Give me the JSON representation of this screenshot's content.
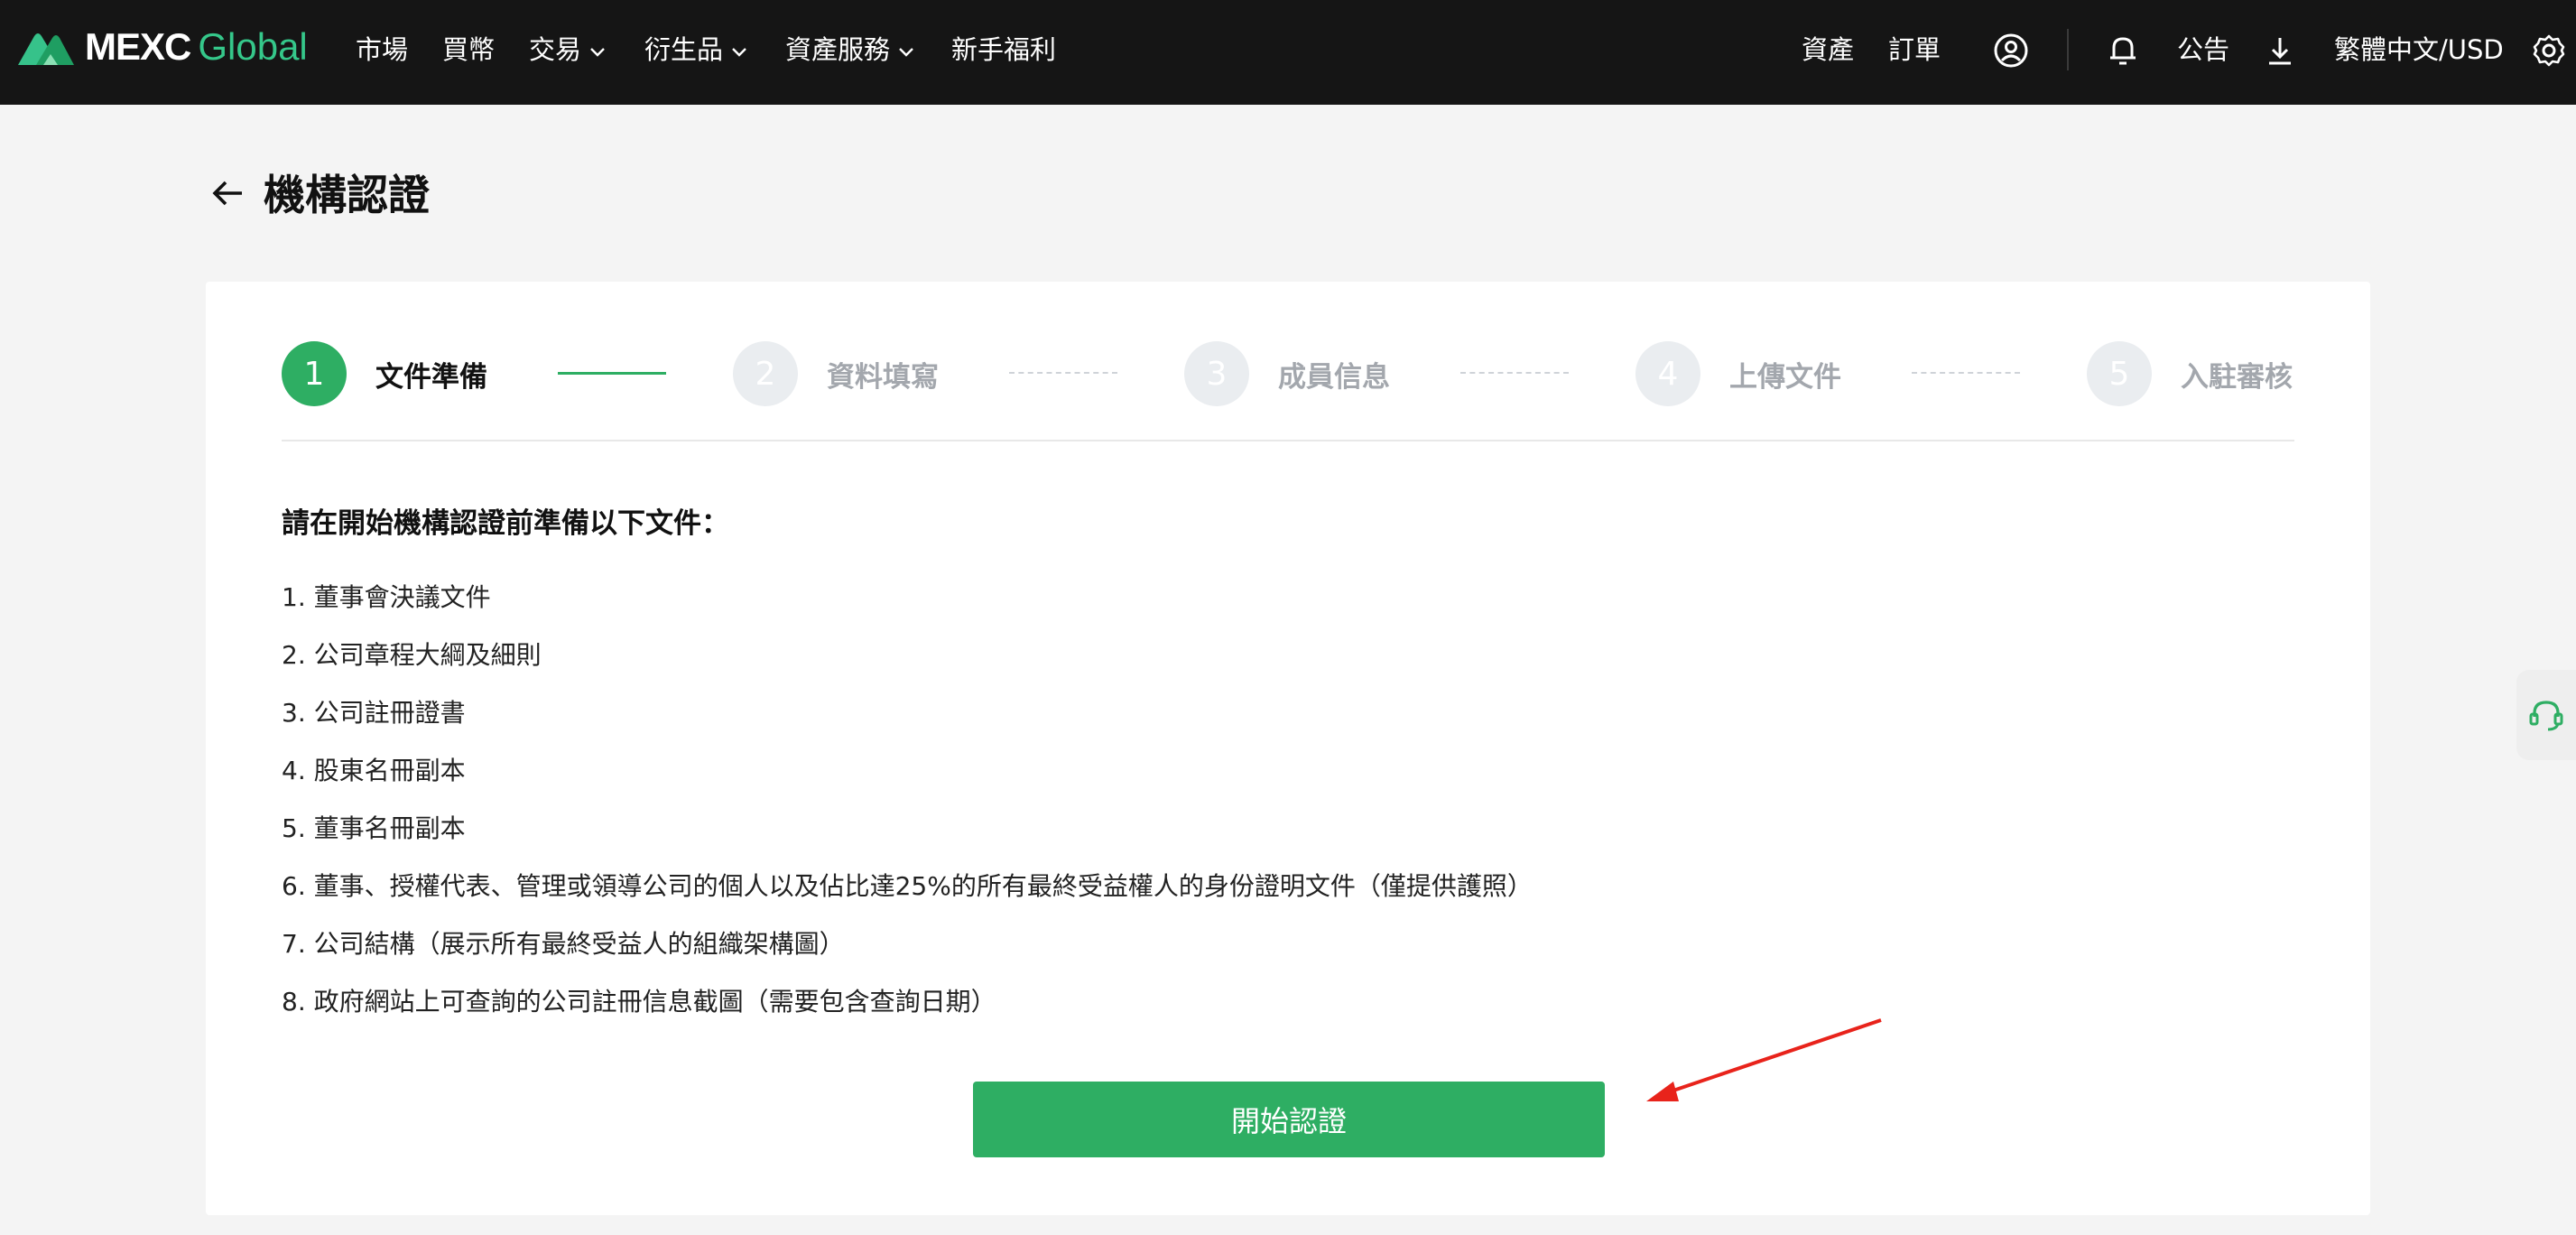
{
  "brand": {
    "name_main": "MEXC",
    "name_sub": "Global",
    "accent": "#2eae63"
  },
  "nav": {
    "left": [
      {
        "label": "市場",
        "dropdown": false
      },
      {
        "label": "買幣",
        "dropdown": false
      },
      {
        "label": "交易",
        "dropdown": true
      },
      {
        "label": "衍生品",
        "dropdown": true
      },
      {
        "label": "資產服務",
        "dropdown": true
      },
      {
        "label": "新手福利",
        "dropdown": false
      }
    ],
    "right": {
      "assets": "資產",
      "orders": "訂單",
      "announcements": "公告",
      "language_currency": "繁體中文/USD"
    },
    "icons": [
      "user-icon",
      "bell-icon",
      "download-icon",
      "gear-icon"
    ]
  },
  "page": {
    "title": "機構認證"
  },
  "steps": [
    {
      "number": "1",
      "label": "文件準備",
      "state": "active"
    },
    {
      "number": "2",
      "label": "資料填寫",
      "state": "inactive"
    },
    {
      "number": "3",
      "label": "成員信息",
      "state": "inactive"
    },
    {
      "number": "4",
      "label": "上傳文件",
      "state": "inactive"
    },
    {
      "number": "5",
      "label": "入駐審核",
      "state": "inactive"
    }
  ],
  "content": {
    "intro": "請在開始機構認證前準備以下文件：",
    "documents": [
      "1. 董事會決議文件",
      "2. 公司章程大綱及細則",
      "3. 公司註冊證書",
      "4. 股東名冊副本",
      "5. 董事名冊副本",
      "6. 董事、授權代表、管理或領導公司的個人以及佔比達25%的所有最終受益權人的身份證明文件（僅提供護照）",
      "7. 公司結構（展示所有最終受益人的組織架構圖）",
      "8. 政府網站上可查詢的公司註冊信息截圖（需要包含查詢日期）"
    ],
    "start_button": "開始認證"
  },
  "annotation": {
    "arrow_color": "#e8231b"
  },
  "floating": {
    "icon": "headset-icon"
  }
}
